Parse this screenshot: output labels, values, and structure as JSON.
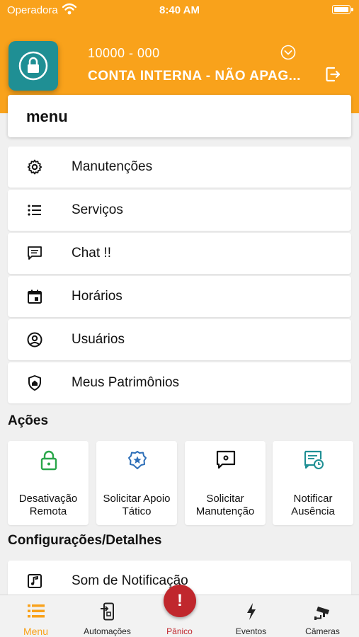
{
  "status_bar": {
    "carrier": "Operadora",
    "time": "8:40 AM"
  },
  "header": {
    "account_number": "10000 - 000",
    "account_name": "CONTA INTERNA - NÃO APAG...",
    "accent_color": "#f9a21b",
    "tile_color": "#1f8f94"
  },
  "menu_title": "menu",
  "menu_items": [
    {
      "label": "Manutenções",
      "icon": "gear-icon"
    },
    {
      "label": "Serviços",
      "icon": "list-icon"
    },
    {
      "label": "Chat !!",
      "icon": "chat-icon"
    },
    {
      "label": "Horários",
      "icon": "calendar-icon"
    },
    {
      "label": "Usuários",
      "icon": "user-circle-icon"
    },
    {
      "label": "Meus Patrimônios",
      "icon": "shield-home-icon"
    }
  ],
  "actions_title": "Ações",
  "actions": [
    {
      "label": "Desativação Remota",
      "icon": "unlock-icon",
      "color": "#2aa64a"
    },
    {
      "label": "Solicitar Apoio Tático",
      "icon": "police-badge-icon",
      "color": "#2e6fb8"
    },
    {
      "label": "Solicitar Manutenção",
      "icon": "maintenance-chat-icon",
      "color": "#111111"
    },
    {
      "label": "Notificar Ausência",
      "icon": "notify-clock-icon",
      "color": "#1f8f94"
    }
  ],
  "config_title": "Configurações/Detalhes",
  "config_items": [
    {
      "label": "Som de Notificação",
      "icon": "music-note-icon"
    }
  ],
  "tabs": [
    {
      "label": "Menu",
      "icon": "menu-icon"
    },
    {
      "label": "Automações",
      "icon": "phone-automation-icon"
    },
    {
      "label": "Pânico",
      "icon": "panic-icon"
    },
    {
      "label": "Eventos",
      "icon": "bolt-icon"
    },
    {
      "label": "Câmeras",
      "icon": "camera-icon"
    }
  ],
  "panic_symbol": "!"
}
